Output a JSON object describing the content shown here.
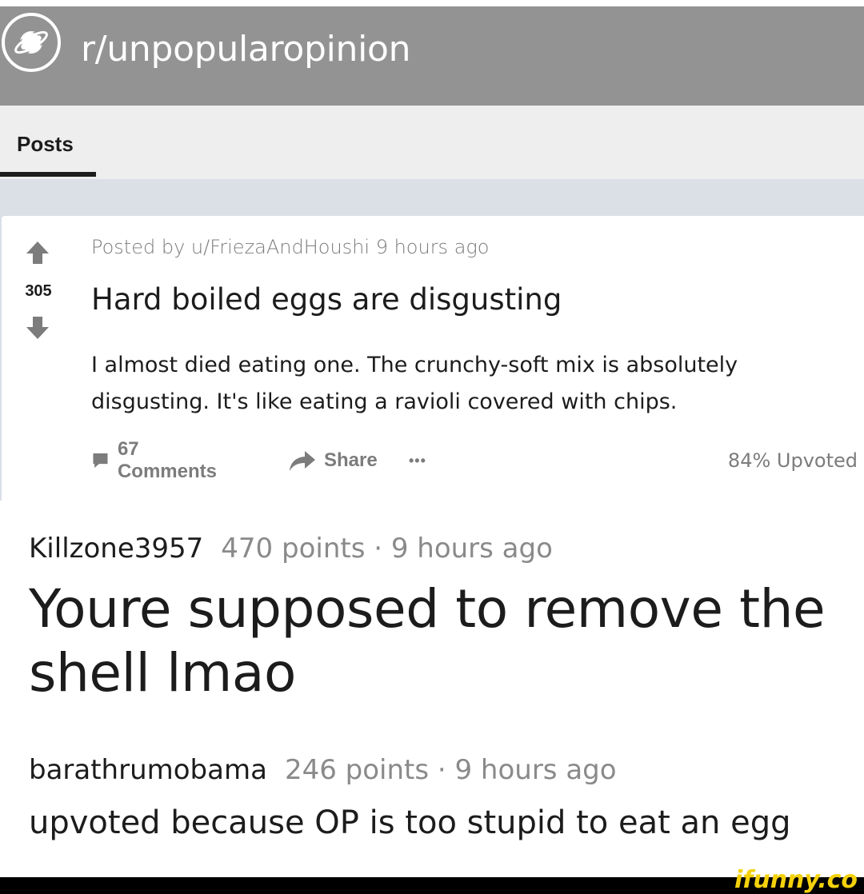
{
  "header": {
    "subreddit": "r/unpopularopinion",
    "icon": "planet-icon",
    "bar_color": "#939393"
  },
  "tabs": [
    {
      "label": "Posts",
      "active": true
    }
  ],
  "post": {
    "votes": "305",
    "posted_by": "Posted by u/FriezaAndHoushi 9 hours ago",
    "title": "Hard boiled eggs are disgusting",
    "body": "I almost died eating one. The crunchy-soft mix is absolutely disgusting. It's like eating a ravioli covered with chips.",
    "actions": {
      "comments": "67 Comments",
      "share": "Share",
      "more": "•••"
    },
    "upvoted": "84% Upvoted"
  },
  "comments": [
    {
      "author": "Killzone3957",
      "points": "470 points · 9 hours ago",
      "text": "Youre supposed to remove the shell lmao"
    },
    {
      "author": "barathrumobama",
      "points": "246 points · 9 hours ago",
      "text": "upvoted because OP is too stupid to eat an egg"
    }
  ],
  "watermark": {
    "text": "ifunny.co",
    "color": "#f4d10b"
  }
}
